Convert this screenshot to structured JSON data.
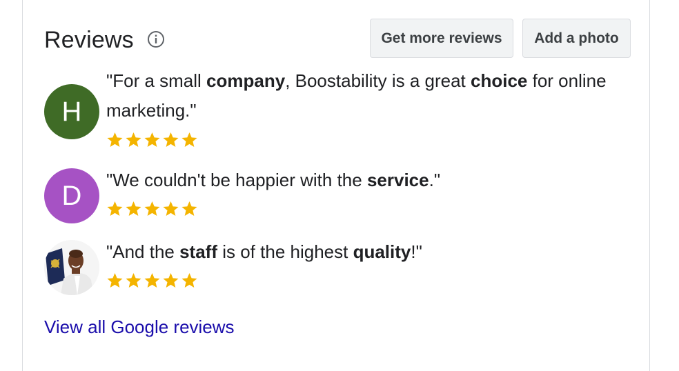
{
  "header": {
    "title": "Reviews",
    "info_icon": "info-icon",
    "get_more_reviews_label": "Get more reviews",
    "add_photo_label": "Add a photo"
  },
  "reviews": [
    {
      "avatar_letter": "H",
      "avatar_color": "#3f6b26",
      "quote_parts": [
        {
          "text": "\"For a small ",
          "bold": false
        },
        {
          "text": "company",
          "bold": true
        },
        {
          "text": ", Boostability is a great ",
          "bold": false
        },
        {
          "text": "choice",
          "bold": true
        },
        {
          "text": " for online marketing.\"",
          "bold": false
        }
      ],
      "rating": 5
    },
    {
      "avatar_letter": "D",
      "avatar_color": "#a652c4",
      "quote_parts": [
        {
          "text": "\"We couldn't be happier with the ",
          "bold": false
        },
        {
          "text": "service",
          "bold": true
        },
        {
          "text": ".\"",
          "bold": false
        }
      ],
      "rating": 5
    },
    {
      "avatar_type": "photo",
      "quote_parts": [
        {
          "text": "\"And the ",
          "bold": false
        },
        {
          "text": "staff",
          "bold": true
        },
        {
          "text": " is of the highest ",
          "bold": false
        },
        {
          "text": "quality",
          "bold": true
        },
        {
          "text": "!\"",
          "bold": false
        }
      ],
      "rating": 5
    }
  ],
  "star_color": "#f4b400",
  "footer": {
    "view_all_label": "View all Google reviews",
    "link_color": "#1a0dab"
  }
}
